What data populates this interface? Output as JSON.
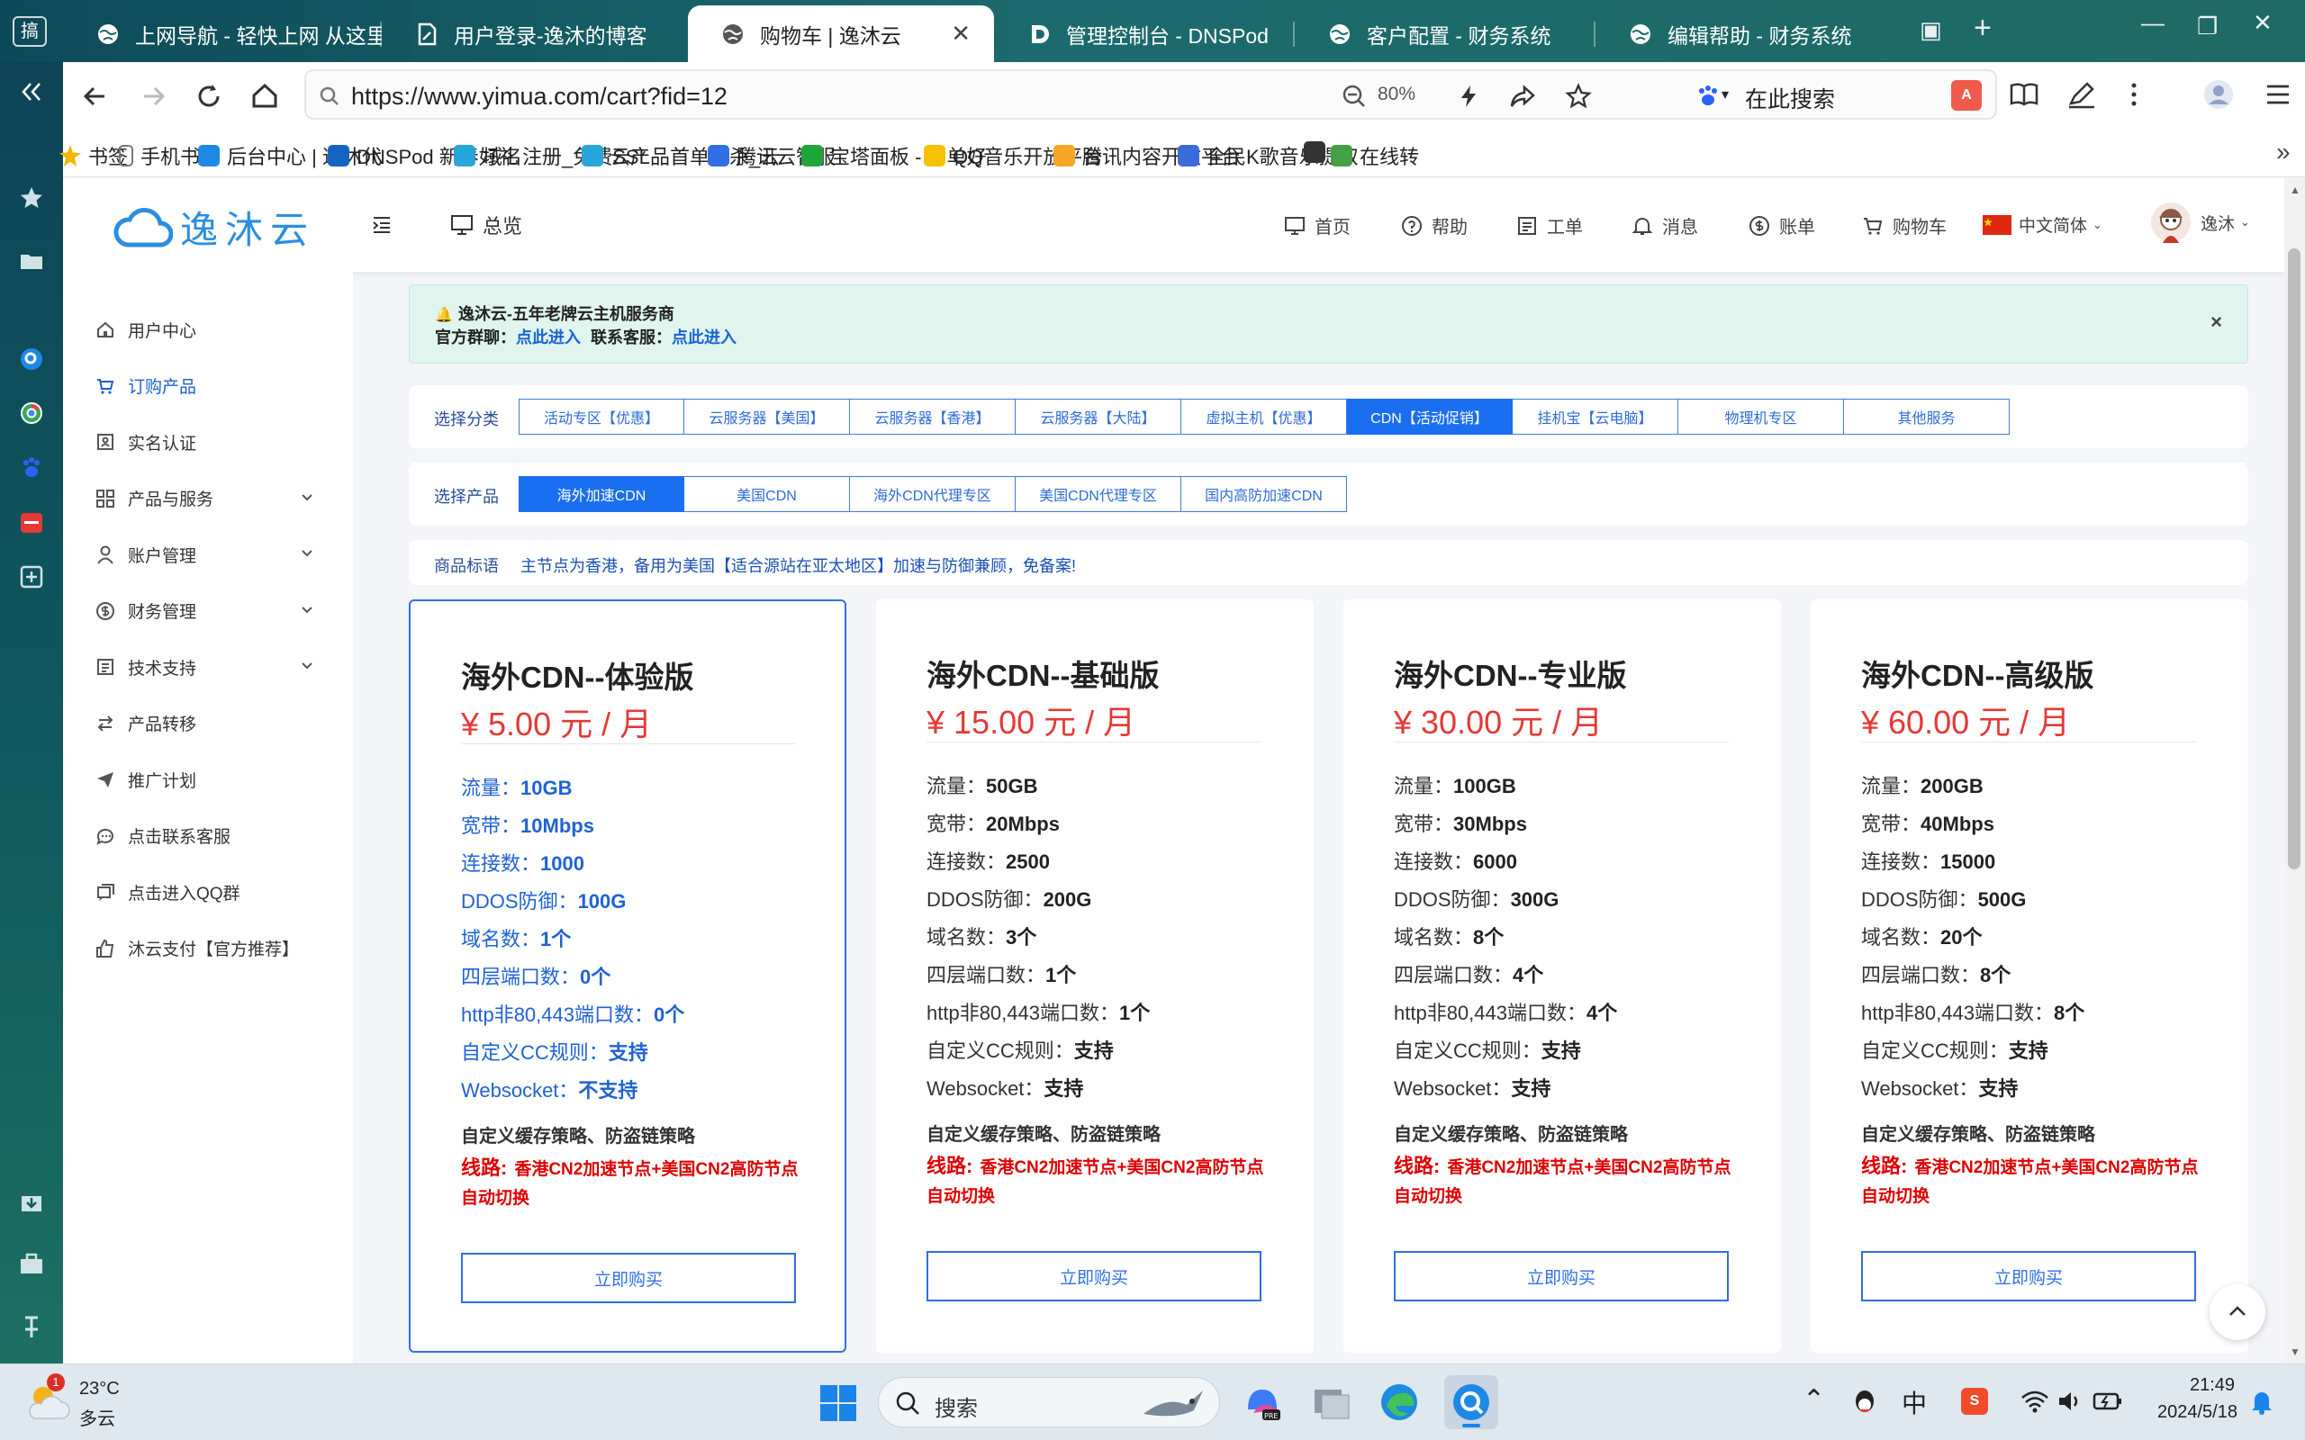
{
  "browser": {
    "app_icon_text": "搞",
    "tabs": [
      {
        "label": "上网导航 - 轻快上网 从这里",
        "active": false
      },
      {
        "label": "用户登录-逸沐的博客",
        "active": false
      },
      {
        "label": "购物车 | 逸沐云",
        "active": true
      },
      {
        "label": "管理控制台 - DNSPod",
        "active": false
      },
      {
        "label": "客户配置 - 财务系统",
        "active": false
      },
      {
        "label": "编辑帮助 - 财务系统",
        "active": false
      }
    ],
    "url": "https://www.yimua.com/cart?fid=12",
    "zoom": "80%",
    "search_placeholder": "在此搜索",
    "bookmarks": [
      {
        "label": "书签",
        "color": "#f4b400"
      },
      {
        "label": "手机书签",
        "color": "#777777"
      },
      {
        "label": "后台中心 | 逸沐代",
        "color": "#1e88e5"
      },
      {
        "label": "DNSPod 新春好礼",
        "color": "#1565c0"
      },
      {
        "label": "域名注册_免费SSL",
        "color": "#26a6d9"
      },
      {
        "label": "云产品首单秒杀_云",
        "color": "#26a6d9"
      },
      {
        "label": "腾讯云智服",
        "color": "#2f6fe3"
      },
      {
        "label": "宝塔面板 - 简单好",
        "color": "#20a53a"
      },
      {
        "label": "QQ音乐开放平台",
        "color": "#f7c200"
      },
      {
        "label": "腾讯内容开放平台",
        "color": "#f5a623"
      },
      {
        "label": "全民K歌音乐提取",
        "color": "#3a6bd8"
      },
      {
        "label": "",
        "color": "#333333"
      },
      {
        "label": "在线转",
        "color": "#43a047"
      }
    ]
  },
  "site": {
    "logo_text": "逸沐云",
    "overview": "总览",
    "nav": [
      {
        "label": "首页",
        "icon": "monitor-icon"
      },
      {
        "label": "帮助",
        "icon": "help-icon"
      },
      {
        "label": "工单",
        "icon": "ticket-icon"
      },
      {
        "label": "消息",
        "icon": "bell-icon"
      },
      {
        "label": "账单",
        "icon": "dollar-icon"
      },
      {
        "label": "购物车",
        "icon": "cart-icon"
      }
    ],
    "language": "中文简体",
    "username": "逸沐"
  },
  "sidebar": {
    "items": [
      {
        "label": "用户中心",
        "icon": "home-icon",
        "expandable": false
      },
      {
        "label": "订购产品",
        "icon": "cart-icon",
        "expandable": false,
        "active": true
      },
      {
        "label": "实名认证",
        "icon": "id-card-icon",
        "expandable": false
      },
      {
        "label": "产品与服务",
        "icon": "grid-icon",
        "expandable": true
      },
      {
        "label": "账户管理",
        "icon": "user-icon",
        "expandable": true
      },
      {
        "label": "财务管理",
        "icon": "dollar-icon",
        "expandable": true
      },
      {
        "label": "技术支持",
        "icon": "document-icon",
        "expandable": true
      },
      {
        "label": "产品转移",
        "icon": "transfer-icon",
        "expandable": false
      },
      {
        "label": "推广计划",
        "icon": "send-icon",
        "expandable": false
      },
      {
        "label": "点击联系客服",
        "icon": "chat-icon",
        "expandable": false
      },
      {
        "label": "点击进入QQ群",
        "icon": "chat-group-icon",
        "expandable": false
      },
      {
        "label": "沐云支付【官方推荐】",
        "icon": "thumbs-up-icon",
        "expandable": false
      }
    ]
  },
  "notice": {
    "title": "逸沐云-五年老牌云主机服务商",
    "group_label": "官方群聊：",
    "group_link": "点此进入",
    "support_label": "联系客服：",
    "support_link": "点此进入"
  },
  "category_filter": {
    "label": "选择分类",
    "options": [
      "活动专区【优惠】",
      "云服务器【美国】",
      "云服务器【香港】",
      "云服务器【大陆】",
      "虚拟主机【优惠】",
      "CDN【活动促销】",
      "挂机宝【云电脑】",
      "物理机专区",
      "其他服务"
    ],
    "selected": 5
  },
  "product_filter": {
    "label": "选择产品",
    "options": [
      "海外加速CDN",
      "美国CDN",
      "海外CDN代理专区",
      "美国CDN代理专区",
      "国内高防加速CDN"
    ],
    "selected": 0
  },
  "tagline": {
    "label": "商品标语",
    "text": "主节点为香港，备用为美国【适合源站在亚太地区】加速与防御兼顾，免备案!"
  },
  "plans": [
    {
      "name": "海外CDN--体验版",
      "price": "¥ 5.00 元 / 月",
      "selected": true,
      "features": [
        [
          "流量：",
          "10GB"
        ],
        [
          "宽带：",
          "10Mbps"
        ],
        [
          "连接数：",
          "1000"
        ],
        [
          "DDOS防御：",
          "100G"
        ],
        [
          "域名数：",
          "1个"
        ],
        [
          "四层端口数：",
          "0个"
        ],
        [
          "http非80,443端口数：",
          "0个"
        ],
        [
          "自定义CC规则：",
          "支持"
        ],
        [
          "Websocket：",
          "不支持"
        ]
      ],
      "extra": "自定义缓存策略、防盗链策略",
      "line_label": "线路:",
      "line_text": "香港CN2加速节点+美国CN2高防节点自动切换",
      "buy": "立即购买"
    },
    {
      "name": "海外CDN--基础版",
      "price": "¥ 15.00 元 / 月",
      "selected": false,
      "features": [
        [
          "流量：",
          "50GB"
        ],
        [
          "宽带：",
          "20Mbps"
        ],
        [
          "连接数：",
          "2500"
        ],
        [
          "DDOS防御：",
          "200G"
        ],
        [
          "域名数：",
          "3个"
        ],
        [
          "四层端口数：",
          "1个"
        ],
        [
          "http非80,443端口数：",
          "1个"
        ],
        [
          "自定义CC规则：",
          "支持"
        ],
        [
          "Websocket：",
          "支持"
        ]
      ],
      "extra": "自定义缓存策略、防盗链策略",
      "line_label": "线路:",
      "line_text": "香港CN2加速节点+美国CN2高防节点自动切换",
      "buy": "立即购买"
    },
    {
      "name": "海外CDN--专业版",
      "price": "¥ 30.00 元 / 月",
      "selected": false,
      "features": [
        [
          "流量：",
          "100GB"
        ],
        [
          "宽带：",
          "30Mbps"
        ],
        [
          "连接数：",
          "6000"
        ],
        [
          "DDOS防御：",
          "300G"
        ],
        [
          "域名数：",
          "8个"
        ],
        [
          "四层端口数：",
          "4个"
        ],
        [
          "http非80,443端口数：",
          "4个"
        ],
        [
          "自定义CC规则：",
          "支持"
        ],
        [
          "Websocket：",
          "支持"
        ]
      ],
      "extra": "自定义缓存策略、防盗链策略",
      "line_label": "线路:",
      "line_text": "香港CN2加速节点+美国CN2高防节点自动切换",
      "buy": "立即购买"
    },
    {
      "name": "海外CDN--高级版",
      "price": "¥ 60.00 元 / 月",
      "selected": false,
      "features": [
        [
          "流量：",
          "200GB"
        ],
        [
          "宽带：",
          "40Mbps"
        ],
        [
          "连接数：",
          "15000"
        ],
        [
          "DDOS防御：",
          "500G"
        ],
        [
          "域名数：",
          "20个"
        ],
        [
          "四层端口数：",
          "8个"
        ],
        [
          "http非80,443端口数：",
          "8个"
        ],
        [
          "自定义CC规则：",
          "支持"
        ],
        [
          "Websocket：",
          "支持"
        ]
      ],
      "extra": "自定义缓存策略、防盗链策略",
      "line_label": "线路:",
      "line_text": "香港CN2加速节点+美国CN2高防节点自动切换",
      "buy": "立即购买"
    }
  ],
  "taskbar": {
    "weather_temp": "23°C",
    "weather_desc": "多云",
    "weather_badge": "1",
    "search_label": "搜索",
    "ime": "中",
    "time": "21:49",
    "date": "2024/5/18"
  },
  "colors": {
    "accent": "#1a6ef0",
    "price": "#e53935",
    "alert": "#e00000"
  }
}
